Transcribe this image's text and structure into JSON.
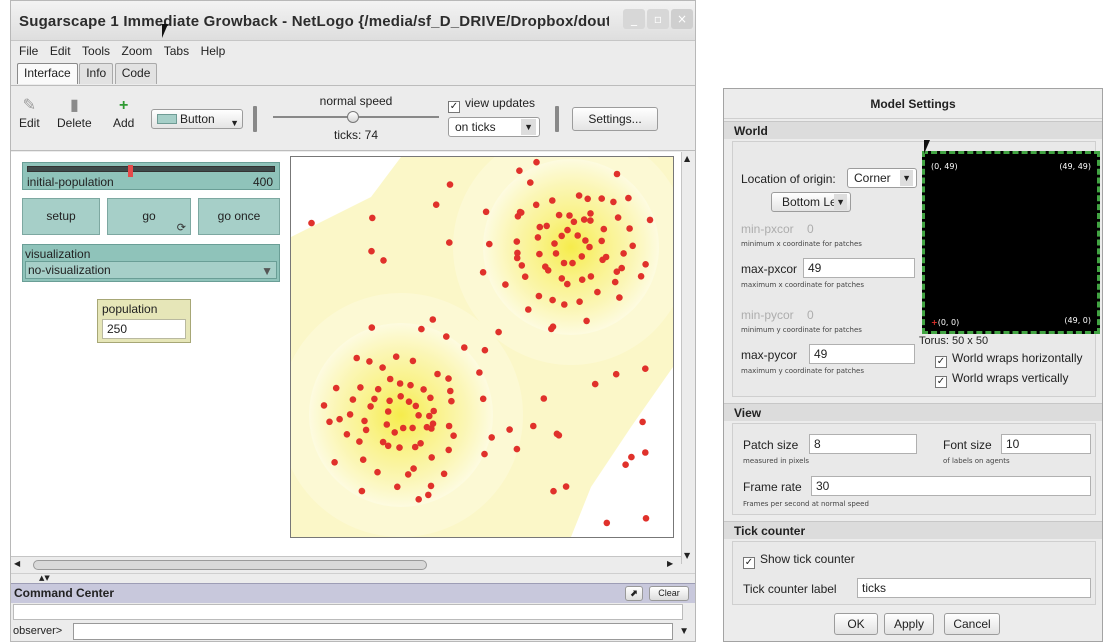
{
  "window": {
    "title": "Sugarscape 1 Immediate Growback - NetLogo {/media/sf_D_DRIVE/Dropbox/doutorado"
  },
  "menu": [
    "File",
    "Edit",
    "Tools",
    "Zoom",
    "Tabs",
    "Help"
  ],
  "tabs": [
    "Interface",
    "Info",
    "Code"
  ],
  "toolbar": {
    "edit_label": "Edit",
    "delete_label": "Delete",
    "add_label": "Add",
    "widget_type": "Button",
    "speed_label": "normal speed",
    "ticks_label": "ticks: 74",
    "view_updates_label": "view updates",
    "view_updates_checked": true,
    "update_mode": "on ticks",
    "settings_label": "Settings..."
  },
  "widgets": {
    "slider": {
      "label": "initial-population",
      "value": "400"
    },
    "setup_label": "setup",
    "go_label": "go",
    "go_once_label": "go once",
    "chooser": {
      "label": "visualization",
      "value": "no-visualization"
    },
    "monitor": {
      "label": "population",
      "value": "250"
    }
  },
  "command_center": {
    "title": "Command Center",
    "clear_label": "Clear",
    "prompt": "observer>"
  },
  "settings_dialog": {
    "title": "Model Settings",
    "world_heading": "World",
    "origin_label": "Location of origin:",
    "origin_value": "Corner",
    "corner_value": "Bottom Left",
    "min_pxcor_label": "min-pxcor",
    "min_pxcor_value": "0",
    "min_pxcor_sub": "minimum x coordinate for patches",
    "max_pxcor_label": "max-pxcor",
    "max_pxcor_value": "49",
    "max_pxcor_sub": "maximum x coordinate for patches",
    "min_pycor_label": "min-pycor",
    "min_pycor_value": "0",
    "min_pycor_sub": "minimum y coordinate for patches",
    "max_pycor_label": "max-pycor",
    "max_pycor_value": "49",
    "max_pycor_sub": "maximum y coordinate for patches",
    "corner_tl": "(0, 49)",
    "corner_tr": "(49, 49)",
    "corner_bl": "(0, 0)",
    "corner_br": "(49, 0)",
    "torus_label": "Torus: 50 x 50",
    "wrap_h_label": "World wraps horizontally",
    "wrap_v_label": "World wraps vertically",
    "view_heading": "View",
    "patch_size_label": "Patch size",
    "patch_size_value": "8",
    "patch_size_sub": "measured in pixels",
    "font_size_label": "Font size",
    "font_size_value": "10",
    "font_size_sub": "of labels on agents",
    "frame_rate_label": "Frame rate",
    "frame_rate_value": "30",
    "frame_rate_sub": "Frames per second at normal speed",
    "tick_heading": "Tick counter",
    "show_tick_label": "Show tick counter",
    "tick_label_label": "Tick counter label",
    "tick_label_value": "ticks",
    "ok_label": "OK",
    "apply_label": "Apply",
    "cancel_label": "Cancel"
  },
  "colors": {
    "agent": "#e0312b",
    "sugar_low": "#fdfbe0",
    "sugar_high": "#f4ea4a",
    "widget_green": "#8fc3ba",
    "monitor": "#e6e6b8",
    "world_border": "#41a342"
  }
}
